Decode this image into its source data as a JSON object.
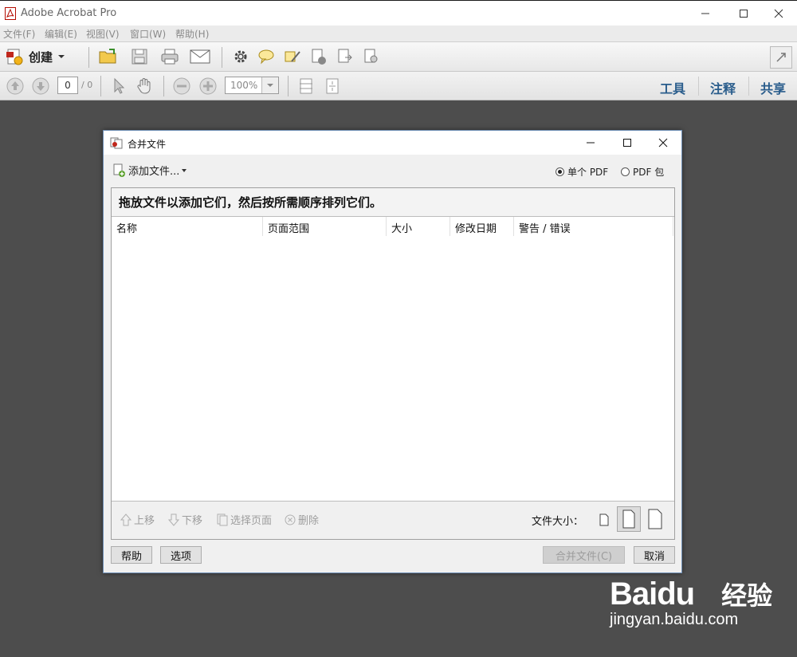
{
  "window": {
    "title": "Adobe Acrobat Pro"
  },
  "menu": [
    "文件(F)",
    "编辑(E)",
    "视图(V)",
    "窗口(W)",
    "帮助(H)"
  ],
  "toolbar": {
    "create_label": "创建"
  },
  "nav": {
    "page_value": "0",
    "page_total": "/ 0",
    "zoom_value": "100%"
  },
  "right_links": {
    "tools": "工具",
    "comment": "注释",
    "share": "共享"
  },
  "dialog": {
    "title": "合并文件",
    "add_files_label": "添加文件...",
    "radio_single": "单个 PDF",
    "radio_package": "PDF 包",
    "drop_message": "拖放文件以添加它们，然后按所需顺序排列它们。",
    "columns": [
      "名称",
      "页面范围",
      "大小",
      "修改日期",
      "警告 / 错误"
    ],
    "actions": {
      "move_up": "上移",
      "move_down": "下移",
      "select_pages": "选择页面",
      "delete": "删除"
    },
    "file_size_label": "文件大小：",
    "help_button": "帮助",
    "options_button": "选项",
    "combine_button": "合并文件(C)",
    "cancel_button": "取消"
  },
  "watermark": {
    "brand": "Baidu",
    "suffix": "经验",
    "url": "jingyan.baidu.com"
  }
}
